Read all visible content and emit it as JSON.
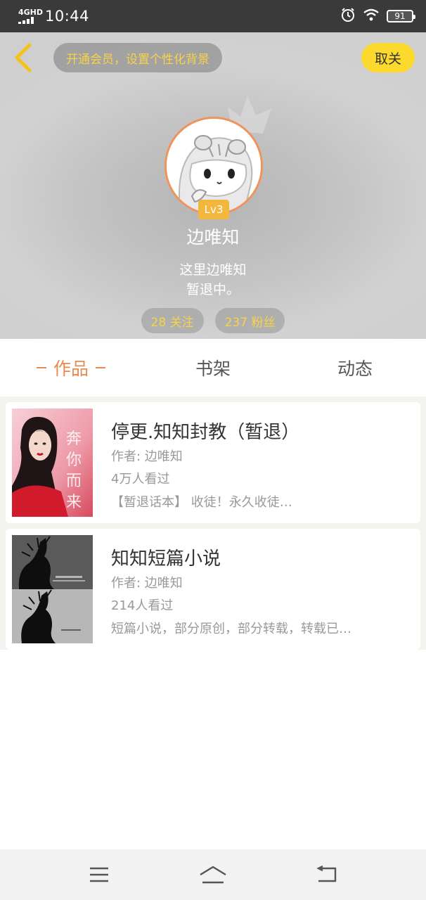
{
  "status_bar": {
    "network": "4GHD",
    "time": "10:44",
    "battery": "91"
  },
  "header": {
    "vip_prompt": "开通会员，设置个性化背景",
    "unfollow_label": "取关",
    "level": "Lv3",
    "username": "边唯知",
    "bio_line1": "这里边唯知",
    "bio_line2": "暂退中。",
    "following": "28 关注",
    "followers": "237 粉丝"
  },
  "tabs": {
    "works": "作品",
    "bookshelf": "书架",
    "moments": "动态",
    "active": "works"
  },
  "books": [
    {
      "title": "停更.知知封教（暂退）",
      "author": "作者: 边唯知",
      "views": "4万人看过",
      "description": "【暂退话本】 收徒！永久收徒…",
      "cover_text": "奔你而来"
    },
    {
      "title": "知知短篇小说",
      "author": "作者: 边唯知",
      "views": "214人看过",
      "description": "短篇小说，部分原创，部分转载，转载已…"
    }
  ],
  "colors": {
    "accent_orange": "#e98a50",
    "accent_yellow": "#fbd92d",
    "pill_text": "#f6d34a"
  }
}
